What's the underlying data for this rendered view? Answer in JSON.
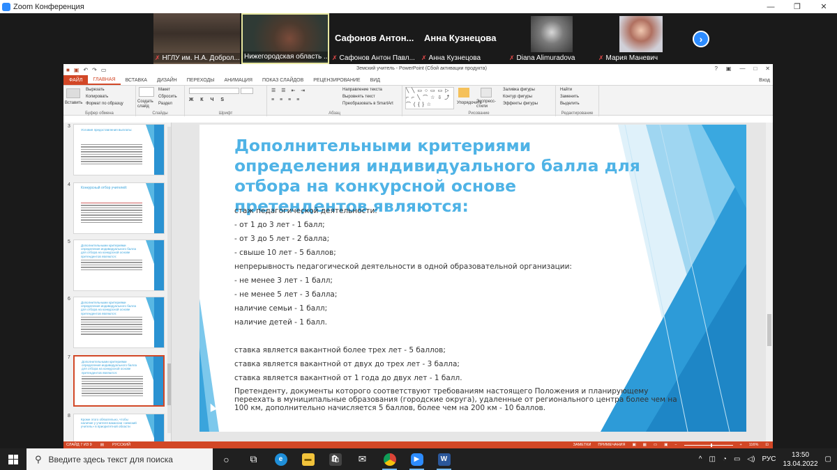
{
  "zoom": {
    "title": "Zoom Конференция",
    "participants": [
      {
        "name": "НГЛУ им. Н.А. Доброл...",
        "big": ""
      },
      {
        "name": "Нижегородская область ...",
        "big": ""
      },
      {
        "name": "Сафонов Антон Павл...",
        "big": "Сафонов Антон..."
      },
      {
        "name": "Анна Кузнецова",
        "big": "Анна Кузнецова"
      },
      {
        "name": "Diana Alimuradova",
        "big": ""
      },
      {
        "name": "Мария Маневич",
        "big": ""
      }
    ],
    "next_icon": "chevron-right-icon"
  },
  "ppt": {
    "doc_title": "Земский учитель - PowerPoint (Сбой активации продукта)",
    "tabs": [
      "ФАЙЛ",
      "ГЛАВНАЯ",
      "ВСТАВКА",
      "ДИЗАЙН",
      "ПЕРЕХОДЫ",
      "АНИМАЦИЯ",
      "ПОКАЗ СЛАЙДОВ",
      "РЕЦЕНЗИРОВАНИЕ",
      "ВИД"
    ],
    "user": "Вход",
    "ribbon": {
      "paste": "Вставить",
      "cut": "Вырезать",
      "copy": "Копировать",
      "format_painter": "Формат по образцу",
      "clipboard": "Буфер обмена",
      "new_slide": "Создать слайд",
      "layout": "Макет",
      "reset": "Сбросить",
      "section": "Раздел",
      "slides": "Слайды",
      "font": "Шрифт",
      "text_dir": "Направление текста",
      "align_text": "Выровнять текст",
      "smartart": "Преобразовать в SmartArt",
      "paragraph": "Абзац",
      "arrange": "Упорядочить",
      "quick_styles": "Экспресс-стили",
      "fill": "Заливка фигуры",
      "outline": "Контур фигуры",
      "effects": "Эффекты фигуры",
      "drawing": "Рисование",
      "find": "Найти",
      "replace": "Заменить",
      "select": "Выделить",
      "editing": "Редактирование"
    },
    "thumbs": [
      {
        "num": "3",
        "title": "Условия предоставления выплаты:"
      },
      {
        "num": "4",
        "title": "Конкурсный отбор учителей:"
      },
      {
        "num": "5",
        "title": "Дополнительными критериями определения индивидуального балла для отбора на конкурсной основе претендентов являются:"
      },
      {
        "num": "6",
        "title": "Дополнительными критериями определения индивидуального балла для отбора на конкурсной основе претендентов являются:"
      },
      {
        "num": "7",
        "title": "Дополнительными критериями определения индивидуального балла для отбора на конкурсной основе претендентов являются:"
      },
      {
        "num": "8",
        "title": "Кроме этого обязательно, чтобы наличие у учителя вакансии «земский учитель» в приоритетной области"
      }
    ],
    "slide": {
      "heading": "Дополнительными критериями определения индивидуального балла для отбора на конкурсной основе претендентов являются:",
      "lines": [
        "стаж педагогической деятельности:",
        "- от 1 до 3 лет - 1 балл;",
        "- от 3 до 5 лет - 2 балла;",
        "- свыше 10 лет - 5 баллов;",
        "непрерывность педагогической деятельности в одной образовательной организации:",
        "- не менее 3 лет - 1 балл;",
        "- не менее 5 лет - 3 балла;",
        "наличие семьи - 1 балл;",
        "наличие детей - 1 балл.",
        "ставка является вакантной более трех лет - 5 баллов;",
        "ставка является вакантной от двух до трех лет - 3 балла;",
        "ставка является вакантной от 1 года до двух лет - 1 балл."
      ],
      "paragraph": "Претенденту, документы которого соответствуют требованиям настоящего Положения и планирующему переехать в муниципальные образования (городские округа), удаленные от регионального центра более чем на 100 км, дополнительно начисляется 5 баллов, более чем на 200 км - 10 баллов."
    },
    "status": {
      "slide_of": "СЛАЙД 7 ИЗ 9",
      "lang": "РУССКИЙ",
      "notes": "ЗАМЕТКИ",
      "comments": "ПРИМЕЧАНИЯ",
      "zoom": "116%"
    }
  },
  "taskbar": {
    "search_placeholder": "Введите здесь текст для поиска",
    "lang": "РУС",
    "time": "13:50",
    "date": "13.04.2022"
  },
  "colors": {
    "accent_ppt": "#d24726",
    "slide_title": "#4fb3e6",
    "zoom_blue": "#2d8cff"
  }
}
